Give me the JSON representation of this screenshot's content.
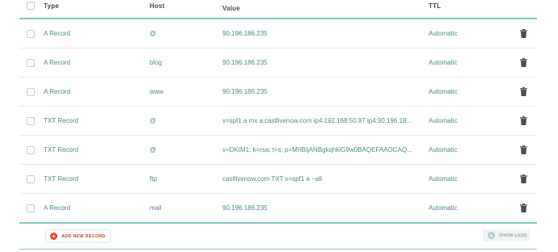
{
  "columns": {
    "type": "Type",
    "host": "Host",
    "value": "Value",
    "ttl": "TTL"
  },
  "records": [
    {
      "type": "A Record",
      "host": "@",
      "value": "90.196.186.235",
      "ttl": "Automatic"
    },
    {
      "type": "A Record",
      "host": "blog",
      "value": "90.196.186.235",
      "ttl": "Automatic"
    },
    {
      "type": "A Record",
      "host": "www",
      "value": "90.196.186.235",
      "ttl": "Automatic"
    },
    {
      "type": "TXT Record",
      "host": "@",
      "value": "v=spf1 a mx a:castlivenow.com ip4:192.168:50.87 ip4:90.196.18...",
      "ttl": "Automatic"
    },
    {
      "type": "TXT Record",
      "host": "@",
      "value": "v=DKIM1; k=rsa; t=s; p=MIIBIjANBgkqhkiG9w0BAQEFAAOCAQ...",
      "ttl": "Automatic"
    },
    {
      "type": "TXT Record",
      "host": "ftp",
      "value": "castlivenow.com TXT v=spf1 a ~all",
      "ttl": "Automatic"
    },
    {
      "type": "A Record",
      "host": "mail",
      "value": "90.196.186.235",
      "ttl": "Automatic"
    }
  ],
  "footer": {
    "add_label": "ADD NEW RECORD",
    "show_less_label": "SHOW LESS"
  },
  "icons": {
    "row_action": "trash-icon",
    "add": "plus-circle-icon",
    "collapse": "chevron-up-icon"
  },
  "colors": {
    "accent": "#7fc7c1",
    "text": "#4c8a86",
    "danger": "#e2412d"
  }
}
